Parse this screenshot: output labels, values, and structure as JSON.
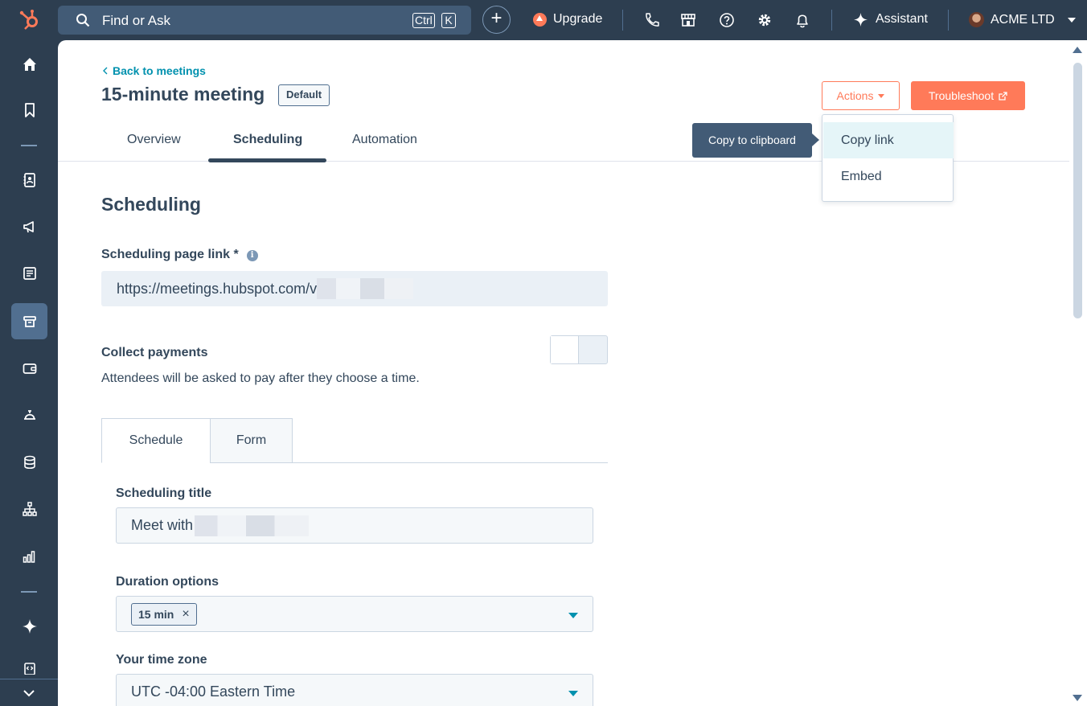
{
  "topbar": {
    "search_text": "Find or Ask",
    "kbd_ctrl": "Ctrl",
    "kbd_k": "K",
    "plus": "+",
    "upgrade": "Upgrade",
    "assistant": "Assistant",
    "account": "ACME LTD"
  },
  "header": {
    "back_link": "Back to meetings",
    "title": "15-minute meeting",
    "badge": "Default",
    "actions_button": "Actions",
    "troubleshoot_button": "Troubleshoot"
  },
  "tabs": [
    "Overview",
    "Scheduling",
    "Automation"
  ],
  "dropdown": {
    "items": [
      "Copy link",
      "Embed"
    ],
    "tooltip": "Copy to clipboard"
  },
  "section": {
    "title": "Scheduling",
    "link_label": "Scheduling page link *",
    "link_value": "https://meetings.hubspot.com/v",
    "payments_label": "Collect payments",
    "payments_desc": "Attendees will be asked to pay after they choose a time."
  },
  "subtabs": [
    "Schedule",
    "Form"
  ],
  "form": {
    "title_label": "Scheduling title",
    "title_value": "Meet with",
    "duration_label": "Duration options",
    "duration_chip": "15 min",
    "chip_remove": "×",
    "timezone_label": "Your time zone",
    "timezone_value": "UTC -04:00 Eastern Time"
  },
  "colors": {
    "nav_bg": "#2d3e50",
    "accent_orange": "#ff7a59",
    "link_teal": "#0091ae",
    "text_dark": "#33475b"
  }
}
